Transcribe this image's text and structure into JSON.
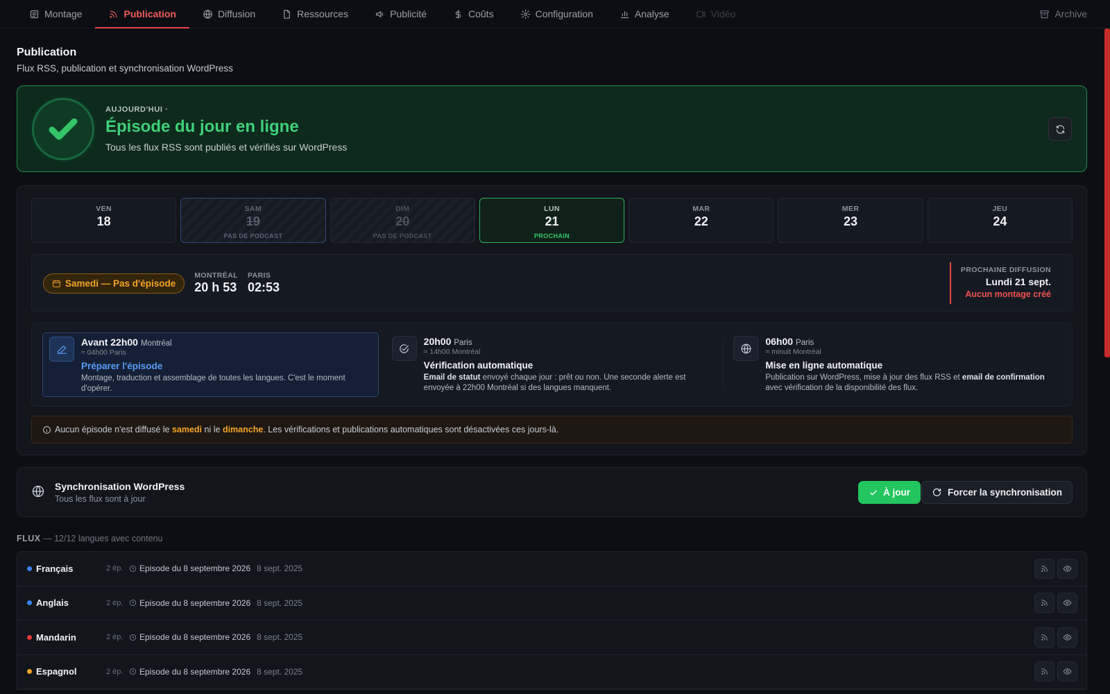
{
  "nav": {
    "tabs": [
      {
        "label": "Montage",
        "icon": "document-icon"
      },
      {
        "label": "Publication",
        "icon": "rss-icon"
      },
      {
        "label": "Diffusion",
        "icon": "globe-icon"
      },
      {
        "label": "Ressources",
        "icon": "file-icon"
      },
      {
        "label": "Publicité",
        "icon": "megaphone-icon"
      },
      {
        "label": "Coûts",
        "icon": "dollar-icon"
      },
      {
        "label": "Configuration",
        "icon": "gear-icon"
      },
      {
        "label": "Analyse",
        "icon": "bar-chart-icon"
      },
      {
        "label": "Vidéo",
        "icon": "video-icon"
      }
    ],
    "archive": "Archive",
    "active_color": "#f05a5a"
  },
  "page": {
    "title": "Publication",
    "subtitle": "Flux RSS, publication et synchronisation WordPress"
  },
  "hero": {
    "kicker": "AUJOURD'HUI ·",
    "title": "Épisode du jour en ligne",
    "description": "Tous les flux RSS sont publiés et vérifiés sur WordPress",
    "accent": "#3fd07a"
  },
  "days": [
    {
      "dow": "VEN",
      "num": "18",
      "tag": ""
    },
    {
      "dow": "SAM",
      "num": "19",
      "tag": "PAS DE PODCAST"
    },
    {
      "dow": "DIM",
      "num": "20",
      "tag": "PAS DE PODCAST"
    },
    {
      "dow": "LUN",
      "num": "21",
      "tag": "PROCHAIN"
    },
    {
      "dow": "MAR",
      "num": "22",
      "tag": ""
    },
    {
      "dow": "MER",
      "num": "23",
      "tag": ""
    },
    {
      "dow": "JEU",
      "num": "24",
      "tag": ""
    }
  ],
  "status": {
    "pill": "Samedi — Pas d'épisode",
    "clocks": [
      {
        "city": "MONTRÉAL",
        "time": "20 h 53"
      },
      {
        "city": "PARIS",
        "time": "02:53"
      }
    ],
    "next_label": "PROCHAINE DIFFUSION",
    "next_date": "Lundi 21 sept.",
    "next_warning": "Aucun montage créé"
  },
  "steps": [
    {
      "time": "Avant 22h00",
      "tz": "Montréal",
      "approx": "≈ 04h00 Paris",
      "title": "Préparer l'épisode",
      "desc": "Montage, traduction et assemblage de toutes les langues. C'est le moment d'opérer.",
      "icon": "pencil-icon"
    },
    {
      "time": "20h00",
      "tz": "Paris",
      "approx": "≈ 14h00 Montréal",
      "title": "Vérification automatique",
      "desc_bold": "Email de statut",
      "desc": " envoyé chaque jour : prêt ou non. Une seconde alerte est envoyée à 22h00 Montréal si des langues manquent.",
      "icon": "check-circle-icon"
    },
    {
      "time": "06h00",
      "tz": "Paris",
      "approx": "≈ minuit Montréal",
      "title": "Mise en ligne automatique",
      "desc_a": "Publication sur WordPress, mise à jour des flux RSS et ",
      "desc_bold": "email de confirmation",
      "desc_b": " avec vérification de la disponibilité des flux.",
      "icon": "globe-icon"
    }
  ],
  "notice": {
    "a": "Aucun épisode n'est diffusé le ",
    "sat": "samedi",
    "b": " ni le ",
    "sun": "dimanche",
    "c": ". Les vérifications et publications automatiques sont désactivées ces jours-là."
  },
  "sync": {
    "title": "Synchronisation WordPress",
    "subtitle": "Tous les flux sont à jour",
    "ok_label": "À jour",
    "force_label": "Forcer la synchronisation"
  },
  "flux": {
    "label": "FLUX",
    "summary": " — 12/12 langues avec contenu",
    "rows": [
      {
        "lang": "Français",
        "color": "#3b82f6",
        "count": "2 ép.",
        "episode": "Episode du 8 septembre 2026",
        "date": "8 sept. 2025"
      },
      {
        "lang": "Anglais",
        "color": "#3b82f6",
        "count": "2 ép.",
        "episode": "Episode du 8 septembre 2026",
        "date": "8 sept. 2025"
      },
      {
        "lang": "Mandarin",
        "color": "#e23b3b",
        "count": "2 ép.",
        "episode": "Episode du 8 septembre 2026",
        "date": "8 sept. 2025"
      },
      {
        "lang": "Espagnol",
        "color": "#f2a528",
        "count": "2 ép.",
        "episode": "Episode du 8 septembre 2026",
        "date": "8 sept. 2025"
      }
    ]
  }
}
